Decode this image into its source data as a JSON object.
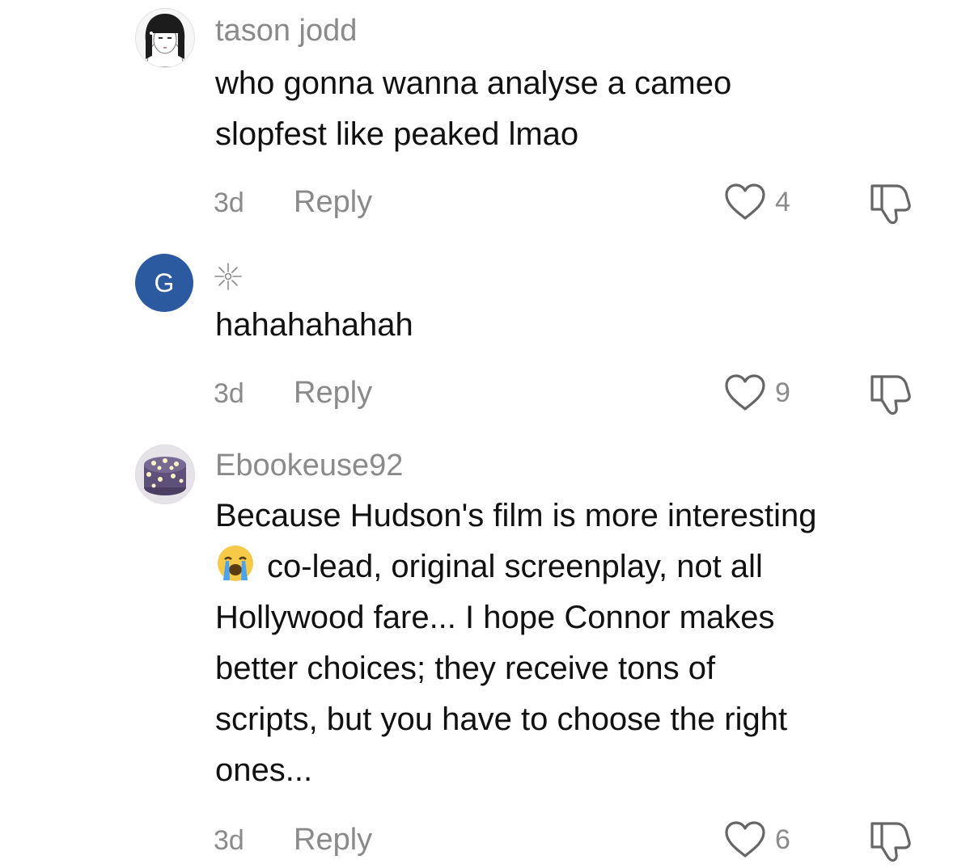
{
  "comments": [
    {
      "username": "tason jodd",
      "lines": [
        "who gonna wanna analyse a cameo",
        "slopfest like peaked lmao"
      ],
      "time": "3d",
      "reply_label": "Reply",
      "likes": "4",
      "avatar_icon": "anime-girl-avatar"
    },
    {
      "username": "",
      "username_icon": "sparkle-icon",
      "lines": [
        "hahahahahah"
      ],
      "time": "3d",
      "reply_label": "Reply",
      "likes": "9",
      "avatar_letter": "G",
      "avatar_color": "#2c5aa0"
    },
    {
      "username": "Ebookeuse92",
      "lines": [
        "Because Hudson's film is more interesting",
        "co-lead, original screenplay, not all",
        "Hollywood fare... I hope Connor makes",
        "better choices; they receive tons of",
        "scripts, but you have to choose the right",
        "ones..."
      ],
      "emoji": "loudly-crying-face",
      "time": "3d",
      "reply_label": "Reply",
      "likes": "6",
      "avatar_icon": "purple-cake-avatar"
    }
  ],
  "colors": {
    "text": "#111111",
    "muted": "#8a8a8a",
    "icon": "#666666"
  }
}
